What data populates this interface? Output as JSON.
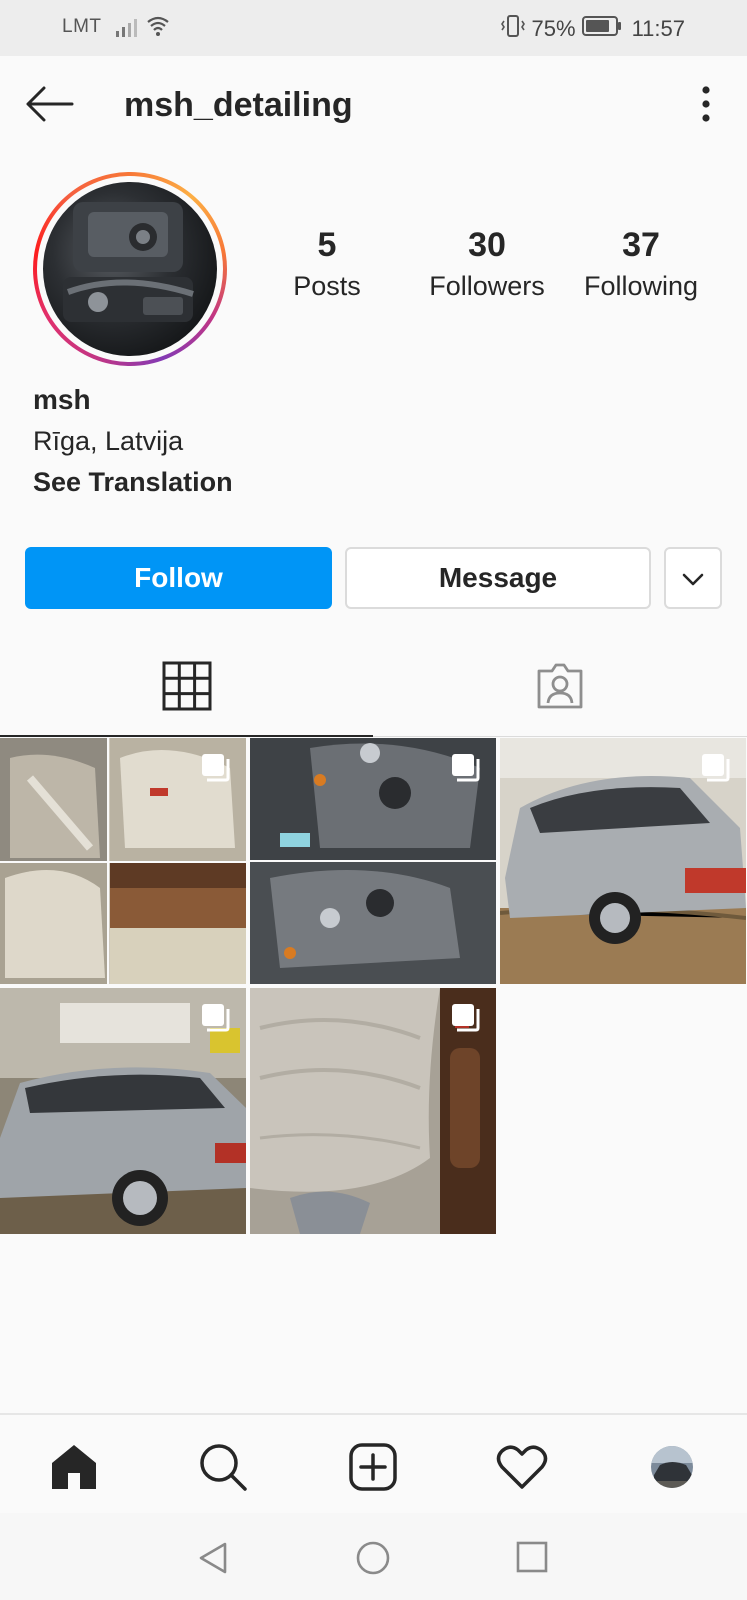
{
  "status_bar": {
    "carrier": "LMT",
    "battery_pct": "75%",
    "time": "11:57"
  },
  "header": {
    "username": "msh_detailing"
  },
  "profile": {
    "stats": [
      {
        "value": "5",
        "label": "Posts"
      },
      {
        "value": "30",
        "label": "Followers"
      },
      {
        "value": "37",
        "label": "Following"
      }
    ],
    "name": "msh",
    "location": "Rīga, Latvija",
    "translate_label": "See Translation"
  },
  "actions": {
    "follow_label": "Follow",
    "message_label": "Message"
  },
  "tabs": {
    "active": "grid-icon",
    "items": [
      "grid-icon",
      "tagged-person-icon"
    ]
  },
  "posts": [
    {
      "subject": "leather car seats collage",
      "multiple": true
    },
    {
      "subject": "VW engine bay collage",
      "multiple": true
    },
    {
      "subject": "silver Audi estate car",
      "multiple": true
    },
    {
      "subject": "silver Audi estate car in garage",
      "multiple": true
    },
    {
      "subject": "leather car seat close-up",
      "multiple": true
    }
  ],
  "bottom_nav": [
    "home-icon",
    "search-icon",
    "new-post-icon",
    "activity-heart-icon",
    "profile-avatar"
  ],
  "colors": {
    "follow_button": "#0095f6",
    "text": "#262626",
    "background": "#fafafa",
    "border": "#dbdbdb"
  }
}
